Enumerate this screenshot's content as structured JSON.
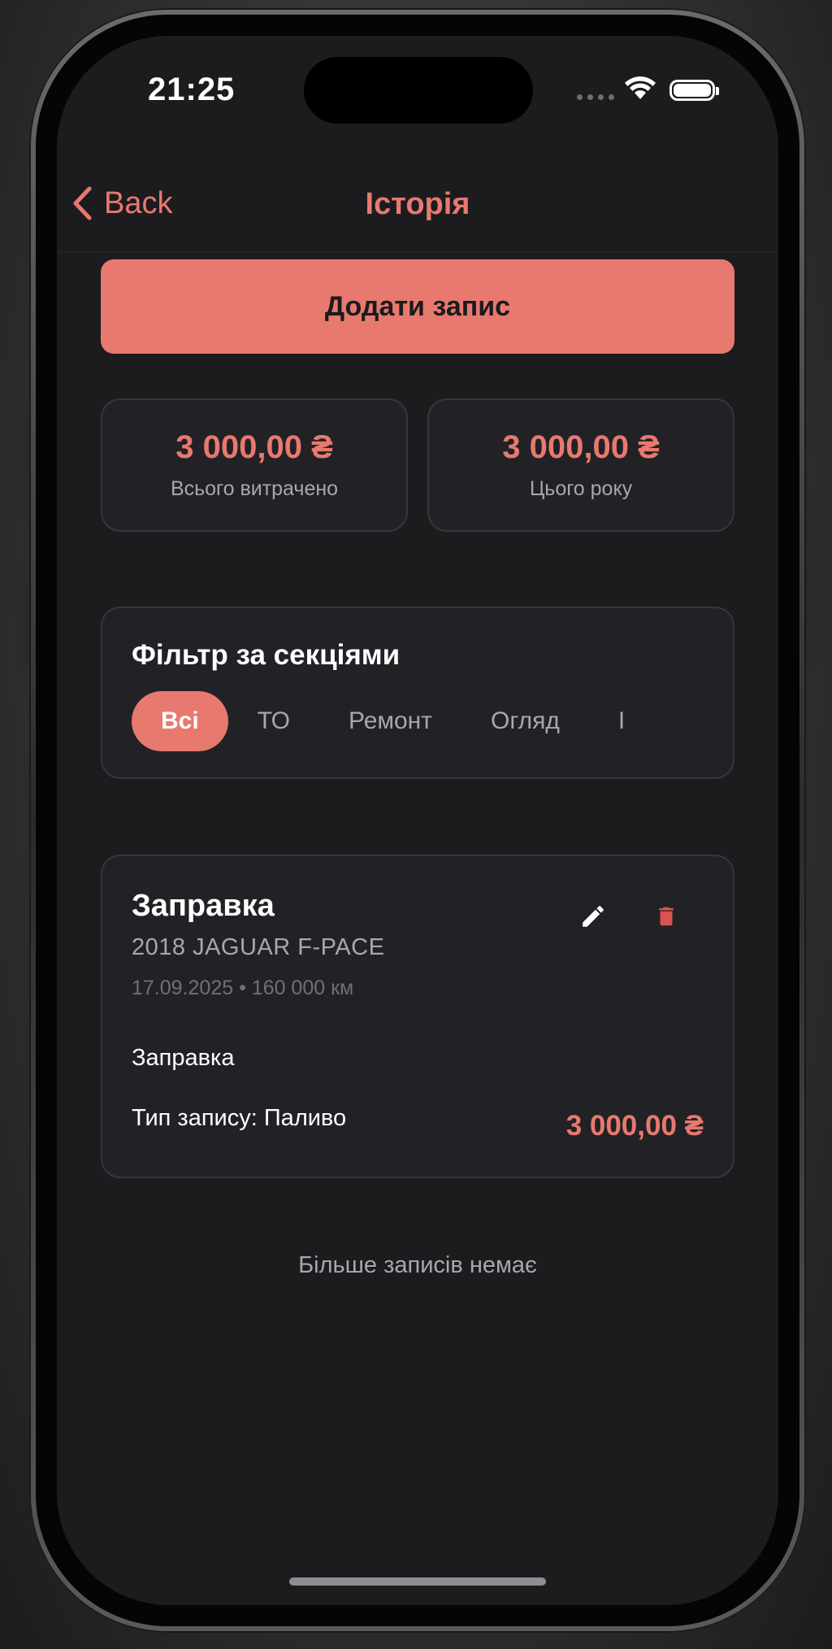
{
  "status": {
    "time": "21:25"
  },
  "nav": {
    "back_label": "Back",
    "title": "Історія"
  },
  "actions": {
    "add_record_label": "Додати запис"
  },
  "stats": [
    {
      "value": "3 000,00 ₴",
      "label": "Всього витрачено"
    },
    {
      "value": "3 000,00 ₴",
      "label": "Цього року"
    }
  ],
  "filter": {
    "title": "Фільтр за секціями",
    "chips": [
      "Всі",
      "ТО",
      "Ремонт",
      "Огляд",
      "І"
    ],
    "selected": "Всі"
  },
  "record": {
    "title": "Заправка",
    "car": "2018 JAGUAR F-PACE",
    "meta": "17.09.2025 • 160 000 км",
    "description": "Заправка",
    "type": "Тип запису: Паливо",
    "amount": "3 000,00 ₴",
    "edit_icon": "pencil-icon",
    "delete_icon": "trash-icon"
  },
  "footer": {
    "no_more": "Більше записів немає"
  },
  "colors": {
    "accent": "#e8796f",
    "delete": "#d9534f",
    "background": "#1c1c1f",
    "card": "#222226"
  }
}
